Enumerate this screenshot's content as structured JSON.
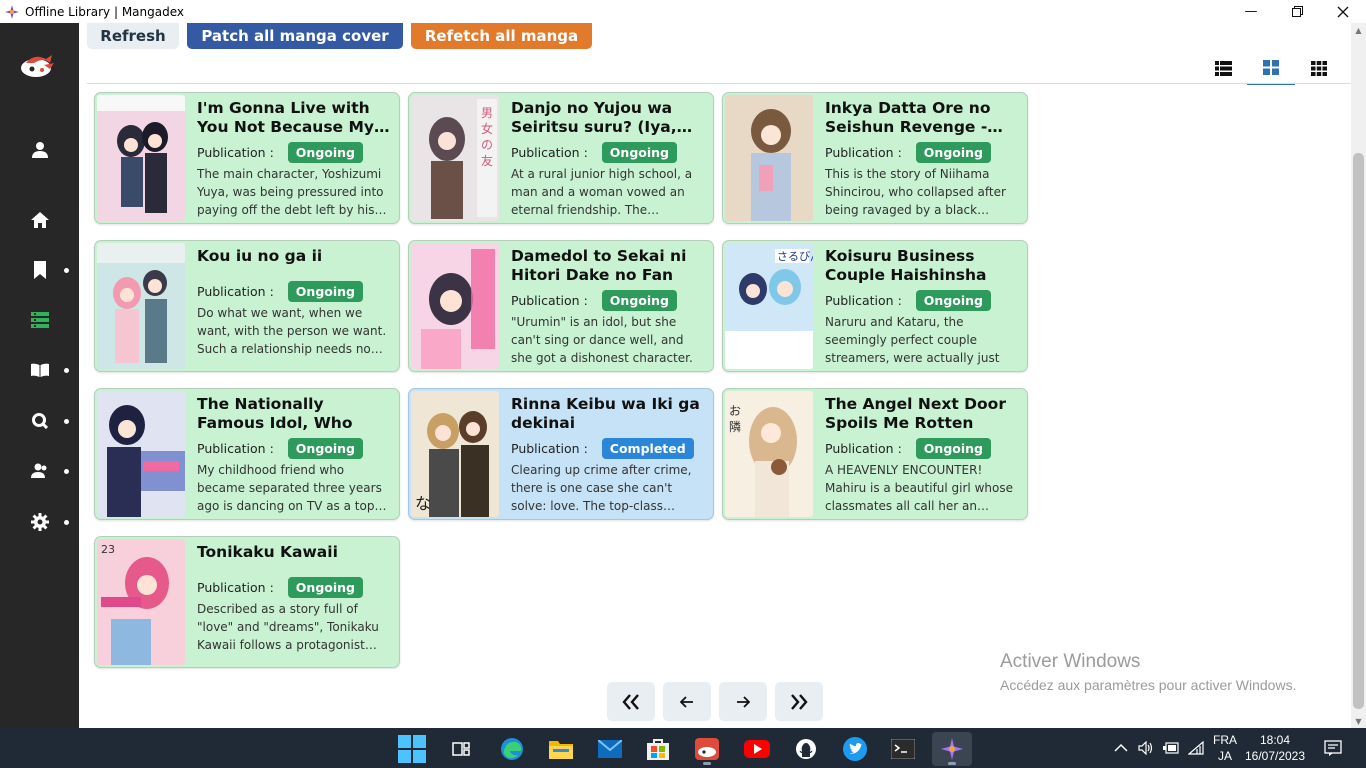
{
  "window": {
    "title": "Offline Library | Mangadex"
  },
  "toolbar": {
    "refresh_label": "Refresh",
    "patch_label": "Patch all manga cover",
    "refetch_label": "Refetch all manga"
  },
  "publication_label": "Publication :",
  "manga": [
    {
      "title": "I'm Gonna Live with You Not Because My…",
      "status": "Ongoing",
      "description": "The main character, Yoshizumi Yuya, was being pressured into paying off the debt left by his…",
      "cover_colors": [
        "#f3d6e4",
        "#2a2a3a",
        "#f2f2f2"
      ]
    },
    {
      "title": "Danjo no Yujou wa Seiritsu suru? (Iya,…",
      "status": "Ongoing",
      "description": "At a rural junior high school, a man and a woman vowed an eternal friendship. The…",
      "cover_colors": [
        "#e9e5e6",
        "#5b4a52",
        "#d45a7a"
      ]
    },
    {
      "title": "Inkya Datta Ore no Seishun Revenge -…",
      "status": "Ongoing",
      "description": "This is the story of Niihama Shincirou, who collapsed after being ravaged by a black…",
      "cover_colors": [
        "#e8d9c6",
        "#7a5a3e",
        "#b7c8de"
      ]
    },
    {
      "title": "Kou iu no ga ii",
      "status": "Ongoing",
      "description": "Do what we want, when we want, with the person we want. Such a relationship needs no…",
      "cover_colors": [
        "#cfe6e6",
        "#f29bb0",
        "#5a7a8a"
      ]
    },
    {
      "title": "Damedol to Sekai ni Hitori Dake no Fan",
      "status": "Ongoing",
      "description": "\"Urumin\" is an idol, but she can't sing or dance well, and she got a dishonest character. Kimiya i…",
      "cover_colors": [
        "#f7d5e6",
        "#3c3346",
        "#f06aa3"
      ]
    },
    {
      "title": "Koisuru Business Couple Haishinsha",
      "status": "Ongoing",
      "description": "Naruru and Kataru, the seemingly perfect couple streamers, were actually just a…",
      "cover_colors": [
        "#cfe7f6",
        "#2e3a6a",
        "#7fc8ea"
      ]
    },
    {
      "title": "The Nationally Famous Idol, Who Turned out t…",
      "status": "Ongoing",
      "description": "My childhood friend who became separated three years ago is dancing on TV as a top…",
      "cover_colors": [
        "#dfe3f2",
        "#1e2240",
        "#8090d0"
      ]
    },
    {
      "title": "Rinna Keibu wa Iki ga dekinai",
      "status": "Completed",
      "description": "Clearing up crime after crime, there is one case she can't solve: love. The top-class…",
      "cover_colors": [
        "#efe6d6",
        "#1d1d1d",
        "#c9a064"
      ]
    },
    {
      "title": "The Angel Next Door Spoils Me Rotten",
      "status": "Ongoing",
      "description": "A HEAVENLY ENCOUNTER! Mahiru is a beautiful girl whose classmates all call her an…",
      "cover_colors": [
        "#f6efe2",
        "#d9b890",
        "#8a5a3a"
      ]
    },
    {
      "title": "Tonikaku Kawaii",
      "status": "Ongoing",
      "description": "Described as a story full of \"love\" and \"dreams\", Tonikaku Kawaii follows a protagonist…",
      "cover_colors": [
        "#f8d0dc",
        "#e55a8a",
        "#8fb8e0"
      ]
    }
  ],
  "watermark": {
    "line1": "Activer Windows",
    "line2": "Accédez aux paramètres pour activer Windows."
  },
  "taskbar": {
    "lang_top": "FRA",
    "lang_bottom": "JA",
    "time": "18:04",
    "date": "16/07/2023"
  },
  "colors": {
    "card_ongoing_bg": "#c8f2d2",
    "card_completed_bg": "#c6e2f7",
    "badge_ongoing": "#2e9a5b",
    "badge_completed": "#2b86d9",
    "sidebar_bg": "#272727",
    "accent": "#e04a3a"
  }
}
